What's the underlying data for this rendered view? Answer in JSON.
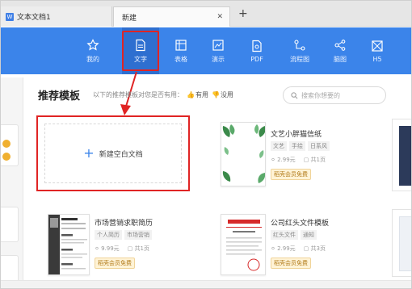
{
  "tabs": [
    {
      "label": "文本文档1",
      "icon": "wps-doc-icon"
    },
    {
      "label": "新建"
    }
  ],
  "toolbar": {
    "accent": "#3b84ea",
    "items": [
      {
        "label": "我的",
        "icon": "star-icon"
      },
      {
        "label": "文字",
        "icon": "document-icon",
        "active": true
      },
      {
        "label": "表格",
        "icon": "table-icon"
      },
      {
        "label": "演示",
        "icon": "slides-icon"
      },
      {
        "label": "PDF",
        "icon": "pdf-icon"
      },
      {
        "label": "流程图",
        "icon": "flowchart-icon"
      },
      {
        "label": "脑图",
        "icon": "mindmap-icon"
      },
      {
        "label": "H5",
        "icon": "h5-icon"
      }
    ]
  },
  "section": {
    "title": "推荐模板",
    "feedback_prompt": "以下的推荐模板对您是否有用：",
    "useful": "有用",
    "useless": "没用"
  },
  "search": {
    "placeholder": "搜索你想要的"
  },
  "blank_doc": {
    "label": "新建空白文档"
  },
  "templates": [
    {
      "name": "文艺小胖猫信纸",
      "tags": [
        "文艺",
        "手绘",
        "日系风"
      ],
      "price": "2.99元",
      "pages": "共1页",
      "badge": "稻壳会员免费"
    },
    {
      "name": "市场营销求职简历",
      "tags": [
        "个人简历",
        "市场营销"
      ],
      "price": "9.99元",
      "pages": "共1页",
      "badge": "稻壳会员免费"
    },
    {
      "name": "公司红头文件模板",
      "tags": [
        "红头文件",
        "通知"
      ],
      "price": "2.99元",
      "pages": "共3页",
      "badge": "稻壳会员免费"
    }
  ],
  "highlight_color": "#e02424"
}
